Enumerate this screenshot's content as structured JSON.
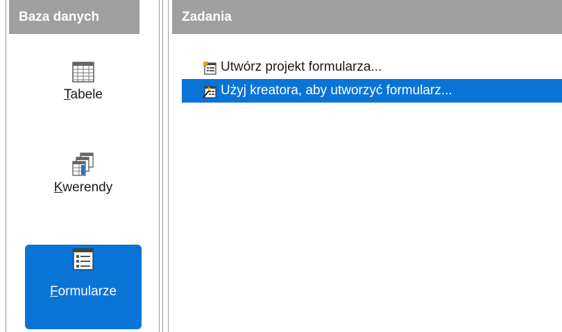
{
  "sidebar": {
    "header": "Baza danych",
    "items": [
      {
        "label": "Tabele",
        "icon": "table-icon",
        "accel": "T",
        "rest": "abele",
        "selected": false
      },
      {
        "label": "Kwerendy",
        "icon": "query-icon",
        "accel": "K",
        "rest": "werendy",
        "selected": false
      },
      {
        "label": "Formularze",
        "icon": "form-icon",
        "accel": "F",
        "rest": "ormularze",
        "selected": true
      }
    ]
  },
  "tasks": {
    "header": "Zadania",
    "items": [
      {
        "label": "Utwórz projekt formularza...",
        "icon": "form-design-icon",
        "selected": false
      },
      {
        "label": "Użyj kreatora, aby utworzyć formularz...",
        "icon": "form-wizard-icon",
        "selected": true
      }
    ]
  },
  "colors": {
    "header_bg": "#9f9f9f",
    "selection": "#0a74d6"
  }
}
